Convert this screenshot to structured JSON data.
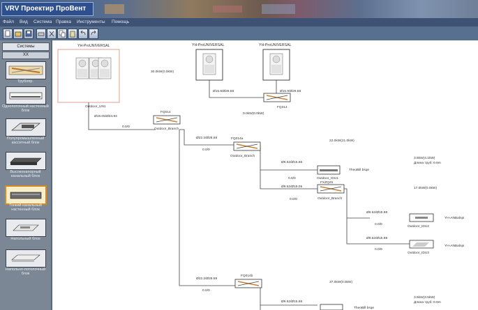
{
  "window": {
    "title": "VRV Проектир ПроВент"
  },
  "menu": [
    "Файл",
    "Вид",
    "Система",
    "Правка",
    "Инструменты",
    "Помощь"
  ],
  "toolbar": {
    "icons": [
      "new-icon",
      "open-icon",
      "save-icon",
      "print-icon",
      "cut-icon",
      "copy-icon",
      "paste-icon",
      "undo-icon",
      "redo-icon"
    ]
  },
  "sidebar": {
    "header": "Системы",
    "subheader": "XX",
    "items": [
      {
        "icon": "pipe-icon",
        "label": "Трубопр.",
        "selected": false
      },
      {
        "icon": "wall-unit-icon",
        "label": "Однопоточный настенный блок",
        "selected": false
      },
      {
        "icon": "cassette-icon",
        "label": "Полупромышленный кассетный блок",
        "selected": false
      },
      {
        "icon": "duct-unit-icon",
        "label": "Высоконапорный канальный блок",
        "selected": false
      },
      {
        "icon": "duct-slim-icon",
        "label": "Тонкий канальный настенный блок",
        "selected": true
      },
      {
        "icon": "floor-unit-icon",
        "label": "Напольный блок",
        "selected": false
      },
      {
        "icon": "ceiling-unit-icon",
        "label": "Напольно-потолочный блок",
        "selected": false
      }
    ]
  },
  "diagram": {
    "units": [
      {
        "name": "YH-ProUNIVERSAL",
        "caption": "Outdoor_UN1"
      },
      {
        "name": "YH-ProUNIVERSAL",
        "caption": ""
      },
      {
        "name": "YH-ProUNIVERSAL",
        "caption": ""
      }
    ],
    "notes": {
      "unit1_note": "30.0kW(0.0kW)",
      "unit3_note": "30.0kW(0.0kW)",
      "outdoor_pipe": "Ø15.9/Ø28.58",
      "branch_top": "0.0kW(0.0kW)",
      "branch_top_cap": "FQ314",
      "main_pipe": "Ø19.05/Ø34.93",
      "main_len": "0.0/0",
      "br1_name": "FQ014",
      "br1_cap": "Outdoor_Branch",
      "br2_pipe": "Ø22.2/Ø28.58",
      "br2_len": "0.0/0",
      "br2_name": "FQ014a",
      "br2_cap": "Outdoor_Branch",
      "br2_note": "22.0kW(21.0kW)",
      "idu1_pipe": "Ø9.52/Ø15.88",
      "idu1_len": "0.0/0",
      "idu1_name": "Outdoor_IDU1",
      "idu1_sub": "FXZQ25",
      "idu1_label": "TheoBill bsqe",
      "idu1_note": "3.5kW(4.1kW)",
      "idu1_note2": "Длина труб: 0.9m",
      "br3_pipe": "Ø9.52/Ø19.05",
      "br3_len": "0.0/0",
      "br3_cap": "Outdoor_Branch",
      "br3_note": "17.0kW(0.0kW)",
      "idu2_pipe": "Ø9.52/Ø15.88",
      "idu2_len": "0.0/0",
      "idu2_name": "Outdoor_IDU2",
      "idu2_label": "YH-ANBalnpi",
      "idu3_pipe": "Ø9.52/Ø15.88",
      "idu3_len": "0.0/0",
      "idu3_name": "Outdoor_IDU3",
      "idu3_label": "YH-ANBalnpi",
      "br4_pipe": "Ø22.2/Ø28.58",
      "br4_len": "0.0/0",
      "br4_name": "FQ014b",
      "br4_cap": "Outdoor_Branch",
      "br4_note": "37.0kW(0.0kW)",
      "bottom_note": "3.5kW(3.5kW)",
      "bottom_note2": "Длина труб: 0.9m",
      "bottom_pipe": "Ø9.52/Ø15.88",
      "bottom_label": "TheoBill bsqe"
    }
  }
}
